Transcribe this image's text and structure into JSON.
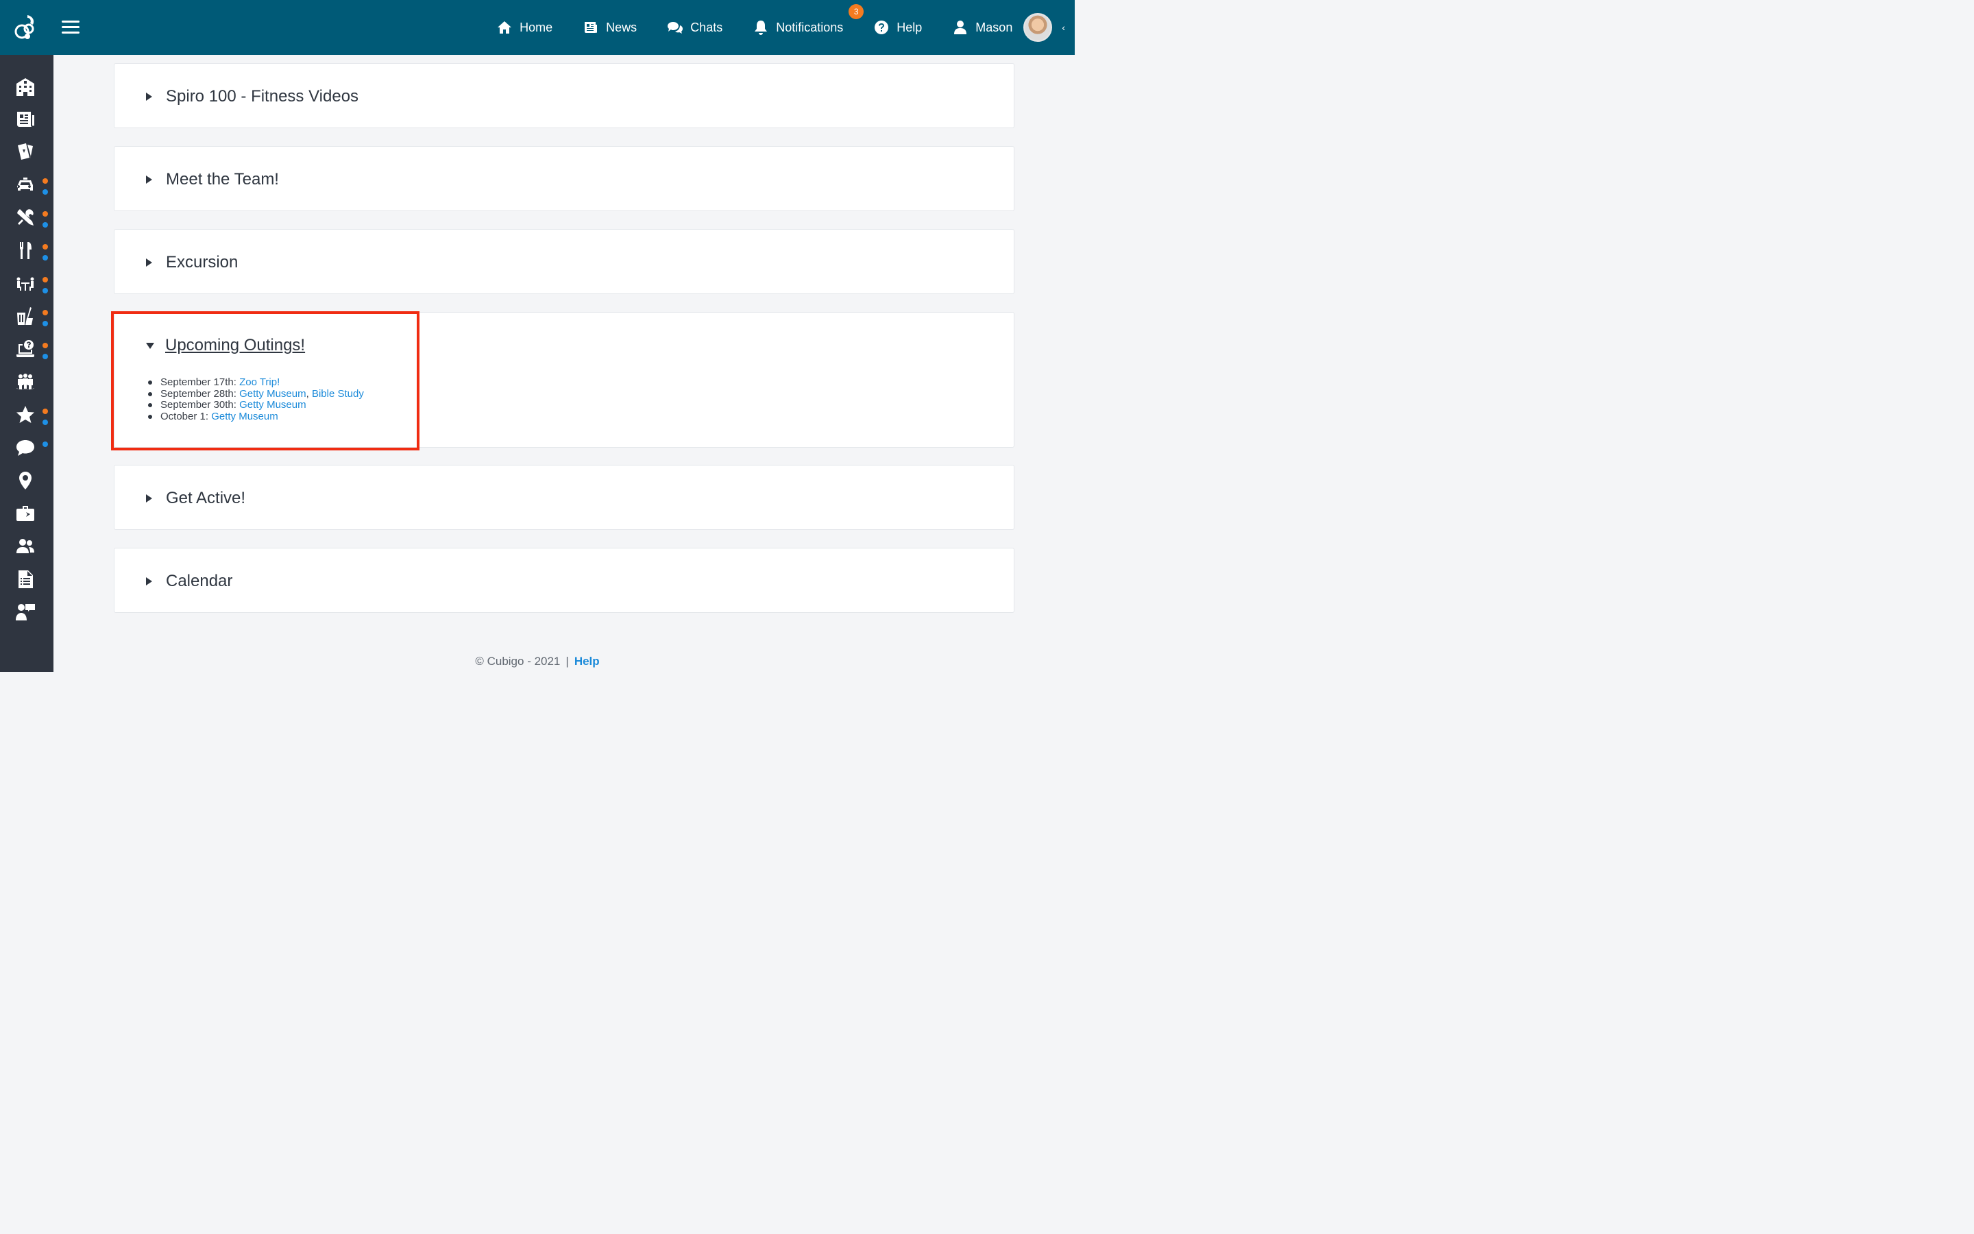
{
  "header": {
    "nav": [
      {
        "label": "Home",
        "icon": "home-icon"
      },
      {
        "label": "News",
        "icon": "newspaper-icon"
      },
      {
        "label": "Chats",
        "icon": "chat-icon"
      },
      {
        "label": "Notifications",
        "icon": "bell-icon",
        "badge": "3"
      },
      {
        "label": "Help",
        "icon": "help-icon"
      },
      {
        "label": "Mason",
        "icon": "user-icon"
      }
    ],
    "caret": "‹"
  },
  "panels": [
    {
      "title": "Spiro 100 - Fitness Videos",
      "expanded": false
    },
    {
      "title": "Meet the Team!",
      "expanded": false
    },
    {
      "title": "Excursion",
      "expanded": false
    },
    {
      "title": "Upcoming Outings!",
      "expanded": true
    },
    {
      "title": "Get Active!",
      "expanded": false
    },
    {
      "title": "Calendar",
      "expanded": false
    }
  ],
  "outings": [
    {
      "date": "September 17th: ",
      "links": [
        "Zoo Trip!"
      ]
    },
    {
      "date": "September 28th: ",
      "links": [
        "Getty Museum",
        "Bible Study"
      ],
      "separator": ", "
    },
    {
      "date": "September 30th: ",
      "links": [
        "Getty Museum"
      ]
    },
    {
      "date": "October 1: ",
      "links": [
        "Getty Museum"
      ]
    }
  ],
  "footer": {
    "copyright": "© Cubigo - 2021",
    "separator": "|",
    "help": "Help"
  },
  "colors": {
    "topbar": "#005a77",
    "sidebar": "#2f3540",
    "link": "#1b8ad9",
    "badge": "#f47b20",
    "highlight": "#f02c12"
  }
}
